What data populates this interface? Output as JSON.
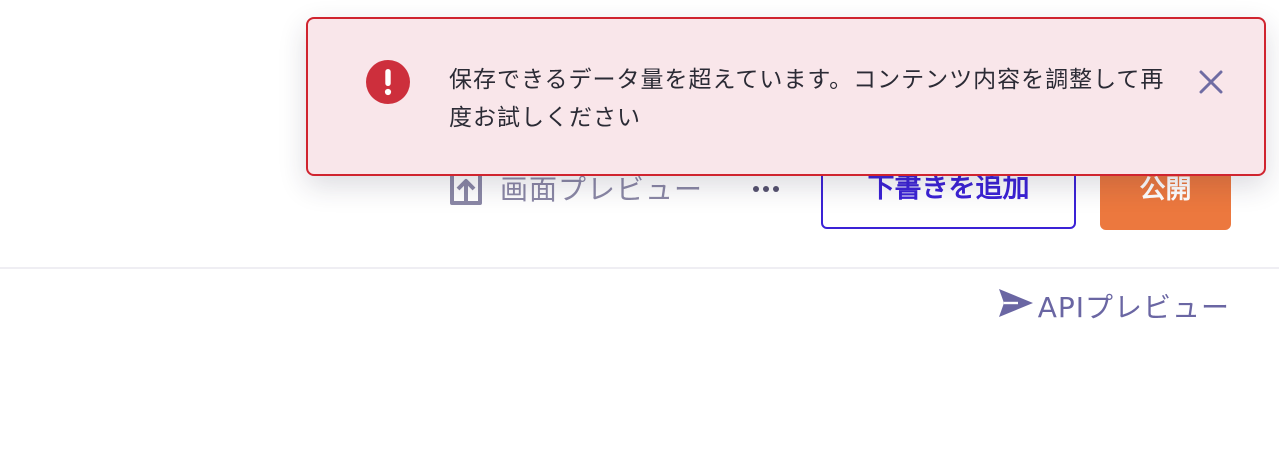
{
  "toolbar": {
    "screen_preview_label": "画面プレビュー",
    "screen_preview_icon": "upload-preview-icon",
    "more_icon": "more-horizontal-icon",
    "save_draft_label": "下書きを追加",
    "publish_label": "公開"
  },
  "api_preview": {
    "label": "APIプレビュー",
    "icon": "send-icon"
  },
  "toast": {
    "type": "error",
    "icon": "error-circle-icon",
    "message": "保存できるデータ量を超えています。コンテンツ内容を調整して再度お試しください",
    "close_icon": "close-icon"
  },
  "colors": {
    "accent": "#3b22d6",
    "publish": "#ec783e",
    "error_border": "#d0242f",
    "error_bg": "#f9e6ea",
    "error_icon": "#cd2f3c",
    "muted_text": "#8b88a6",
    "link_text": "#6a66a3"
  }
}
